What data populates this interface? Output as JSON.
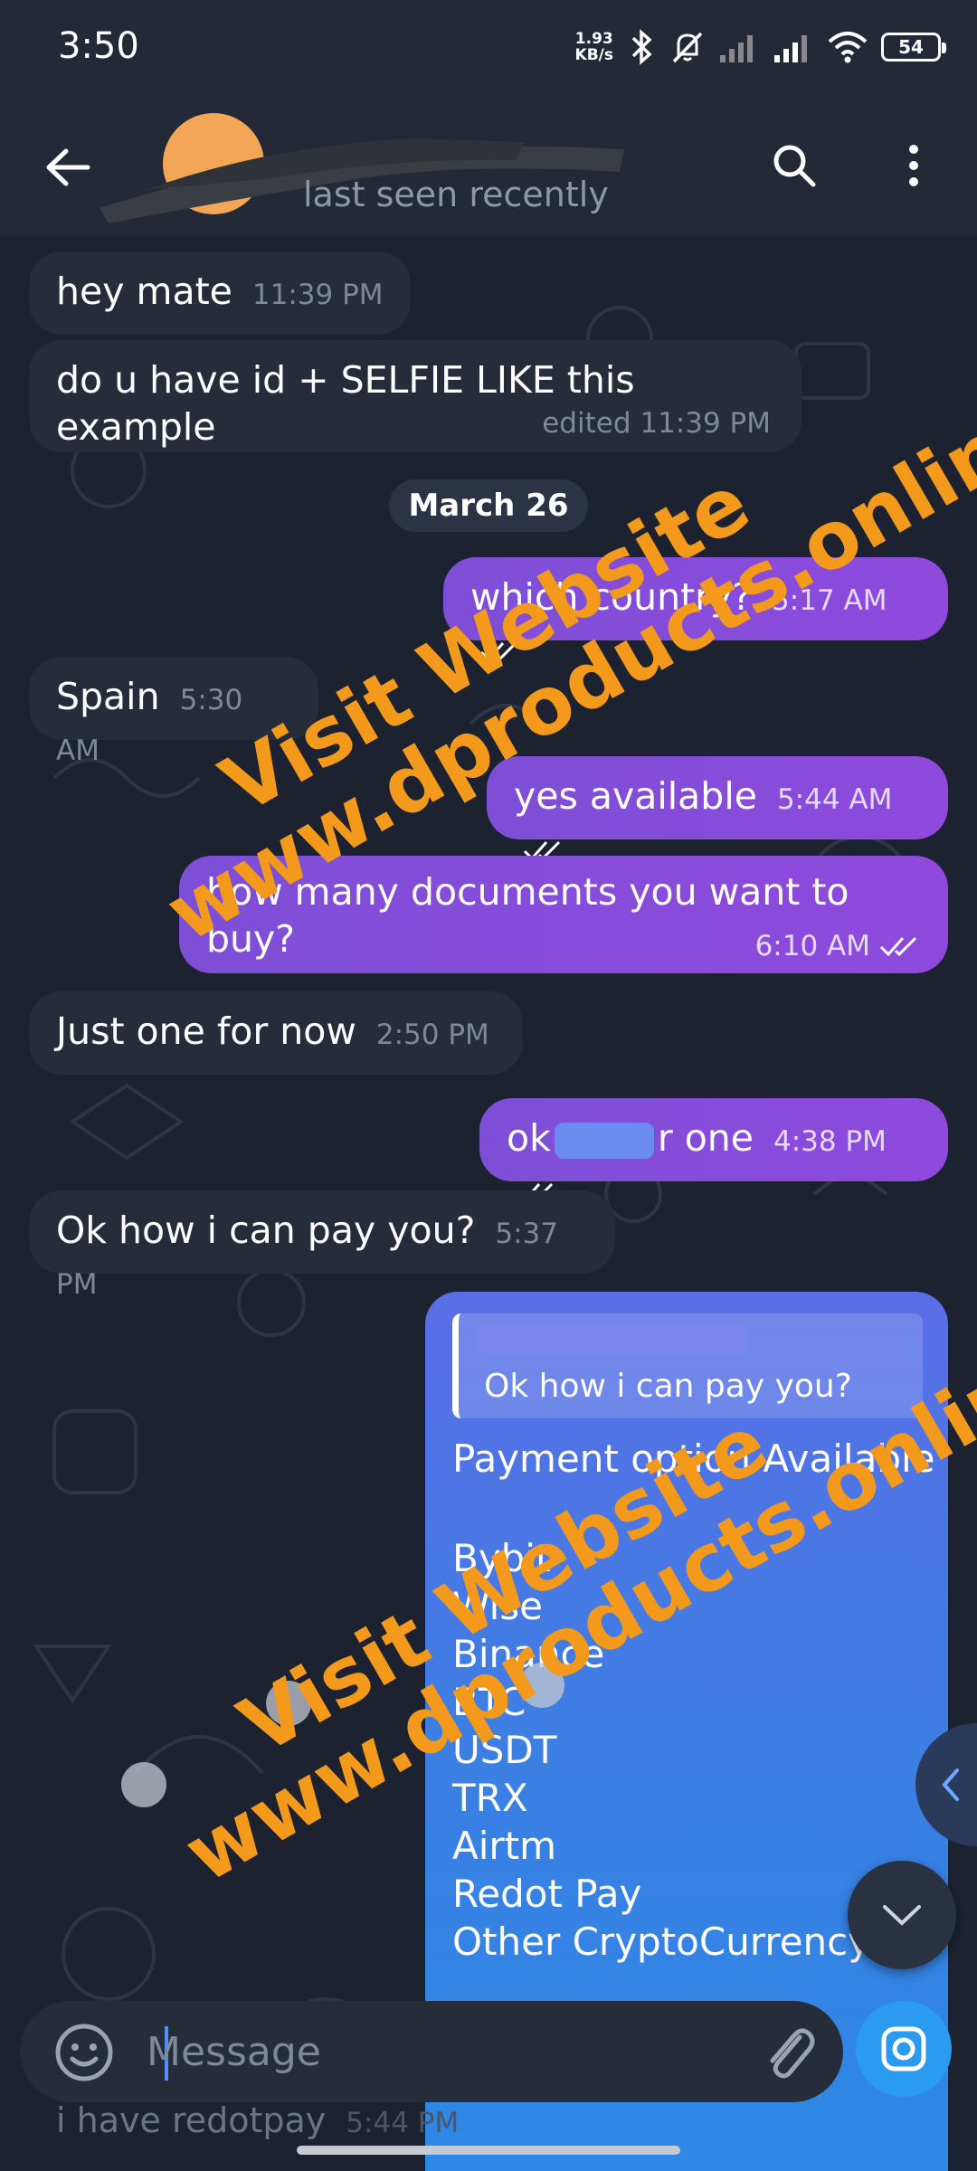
{
  "status_bar": {
    "time": "3:50",
    "speed_value": "1.93",
    "speed_unit": "KB/s",
    "battery": "54"
  },
  "header": {
    "status": "last seen recently"
  },
  "date_chip": "March 26",
  "messages": [
    {
      "text": "hey mate",
      "time": "11:39 PM"
    },
    {
      "text": "do u have id + SELFIE LIKE this example",
      "time": "edited 11:39 PM"
    },
    {
      "text": "which country?",
      "time": "5:17 AM"
    },
    {
      "text": "Spain",
      "time": "5:30 AM"
    },
    {
      "text": "yes available",
      "time": "5:44 AM"
    },
    {
      "text": "how many documents you want to buy?",
      "time": "6:10 AM"
    },
    {
      "text": "Just one for now",
      "time": "2:50 PM"
    },
    {
      "text_a": "ok",
      "text_b": "r one",
      "time": "4:38 PM"
    },
    {
      "text": "Ok how i can pay you?",
      "time": "5:37 PM"
    }
  ],
  "reply_bubble": {
    "quoted": "Ok how i can pay you?",
    "title": "Payment option Available",
    "options": [
      "Bybit",
      "Wise",
      "Binance",
      "BTC",
      "USDT",
      "TRX",
      "Airtm",
      "Redot Pay",
      "Other CryptoCurrency"
    ]
  },
  "input": {
    "placeholder": "Message"
  },
  "draft": {
    "text": "i have redotpay",
    "time": "5:44 PM"
  },
  "watermark": {
    "line1": "Visit Website",
    "line2": "www.dproducts.online"
  },
  "colors": {
    "outgoing": "#8a4bdb",
    "incoming": "#262c39",
    "accent": "#2b9bf0",
    "watermark": "#f39a1c"
  }
}
